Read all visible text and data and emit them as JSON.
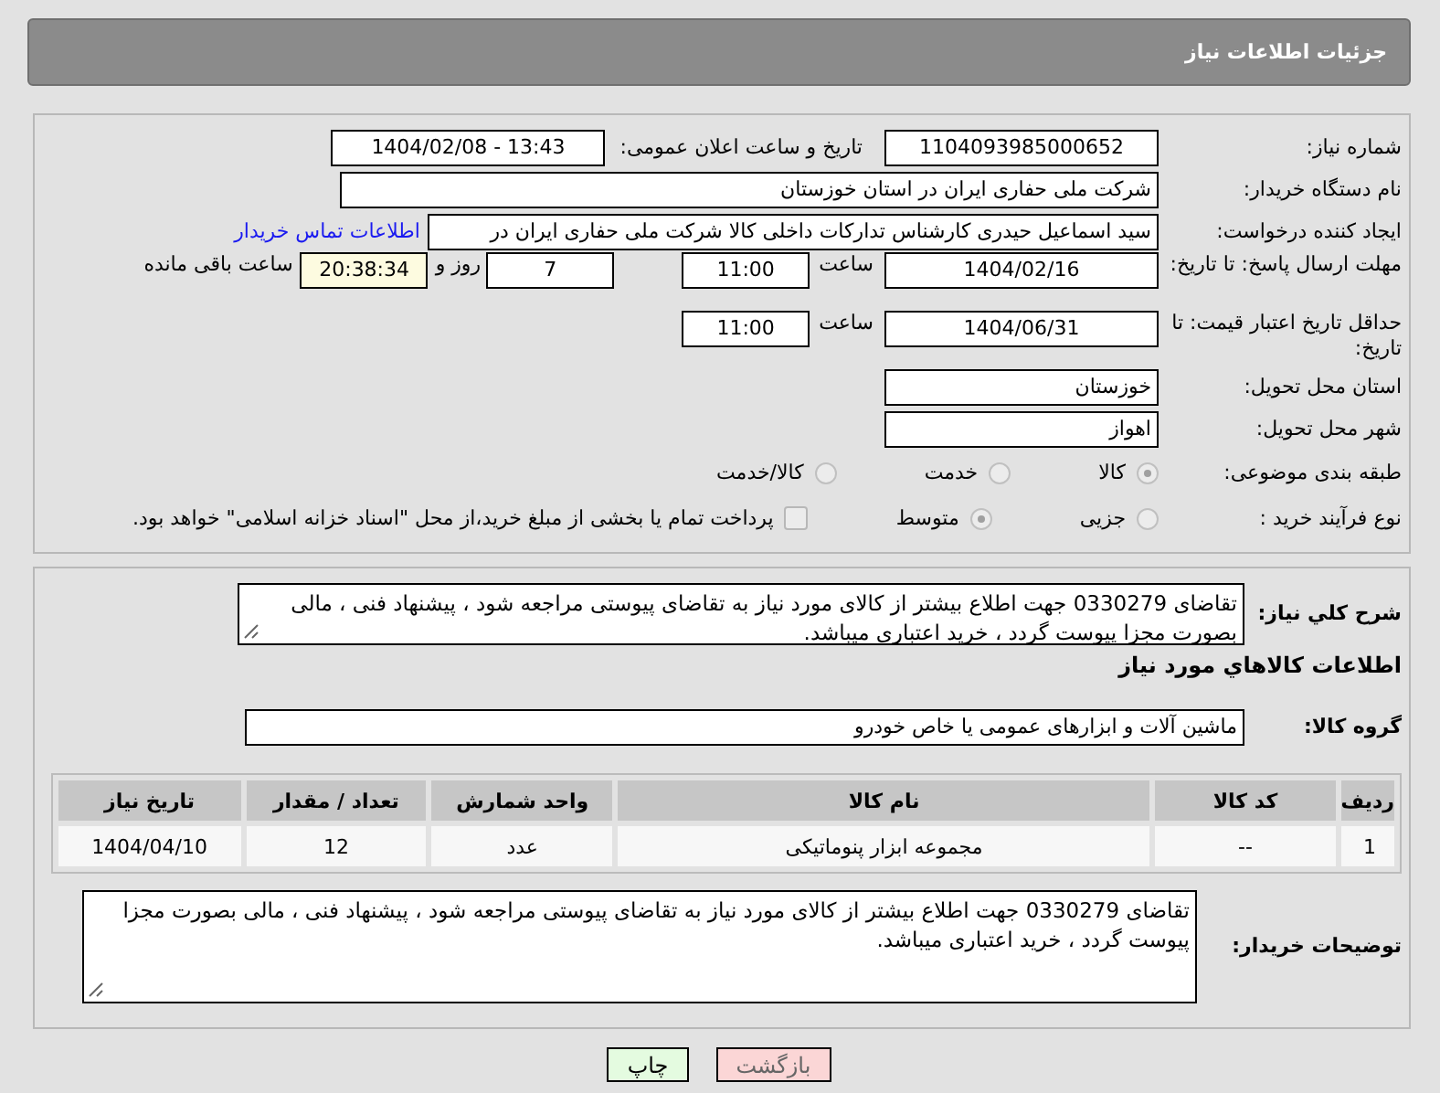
{
  "page_title": "جزئیات اطلاعات نیاز",
  "need_number": {
    "label": "شماره نیاز:",
    "value": "1104093985000652"
  },
  "announce_datetime": {
    "label": "تاریخ و ساعت اعلان عمومی:",
    "value": "1404/02/08 - 13:43"
  },
  "buyer_org": {
    "label": "نام دستگاه خریدار:",
    "value": "شرکت ملی حفاری ایران در استان خوزستان"
  },
  "requester": {
    "label": "ایجاد کننده درخواست:",
    "value": "سید اسماعیل حیدری کارشناس تدارکات داخلی کالا شرکت ملی حفاری ایران در",
    "link": "اطلاعات تماس خریدار"
  },
  "response_deadline": {
    "label": "مهلت ارسال پاسخ: تا تاریخ:",
    "date": "1404/02/16",
    "time_label": "ساعت",
    "time": "11:00",
    "days": "7",
    "days_label": "روز و",
    "remaining": "20:38:34",
    "remaining_label": "ساعت باقی مانده"
  },
  "price_validity": {
    "label": "حداقل تاریخ اعتبار قیمت: تا تاریخ:",
    "date": "1404/06/31",
    "time_label": "ساعت",
    "time": "11:00"
  },
  "province": {
    "label": "استان محل تحویل:",
    "value": "خوزستان"
  },
  "city": {
    "label": "شهر محل تحویل:",
    "value": "اهواز"
  },
  "category": {
    "label": "طبقه بندی موضوعی:",
    "options": [
      {
        "label": "کالا",
        "selected": true
      },
      {
        "label": "خدمت",
        "selected": false
      },
      {
        "label": "کالا/خدمت",
        "selected": false
      }
    ]
  },
  "process": {
    "label": "نوع فرآیند خرید :",
    "options": [
      {
        "label": "جزیی",
        "selected": false
      },
      {
        "label": "متوسط",
        "selected": true
      }
    ],
    "treasury": {
      "label": "پرداخت تمام یا بخشی از مبلغ خرید،از محل \"اسناد خزانه اسلامی\" خواهد بود.",
      "checked": false
    }
  },
  "description": {
    "label": "شرح کلي نياز:",
    "value": "تقاضای 0330279 جهت اطلاع بیشتر از کالای مورد نیاز به تقاضای پیوستی مراجعه شود ، پیشنهاد فنی ، مالی بصورت مجزا پیوست گردد ، خرید اعتباری میباشد."
  },
  "goods_heading": "اطلاعات كالاهاي مورد نياز",
  "goods_group": {
    "label": "گروه کالا:",
    "value": "ماشین آلات و ابزارهای عمومی یا خاص خودرو"
  },
  "table": {
    "columns": [
      "ردیف",
      "کد کالا",
      "نام کالا",
      "واحد شمارش",
      "تعداد / مقدار",
      "تاریخ نیاز"
    ],
    "rows": [
      [
        "1",
        "--",
        "مجموعه ابزار پنوماتیکی",
        "عدد",
        "12",
        "1404/04/10"
      ]
    ]
  },
  "buyer_notes": {
    "label": "توضیحات خریدار:",
    "value": "تقاضای 0330279 جهت اطلاع بیشتر از کالای مورد نیاز به تقاضای پیوستی مراجعه شود ، پیشنهاد فنی ، مالی بصورت مجزا پیوست گردد ، خرید اعتباری میباشد."
  },
  "buttons": [
    {
      "kind": "back",
      "label": "بازگشت"
    },
    {
      "kind": "print",
      "label": "چاپ"
    }
  ]
}
